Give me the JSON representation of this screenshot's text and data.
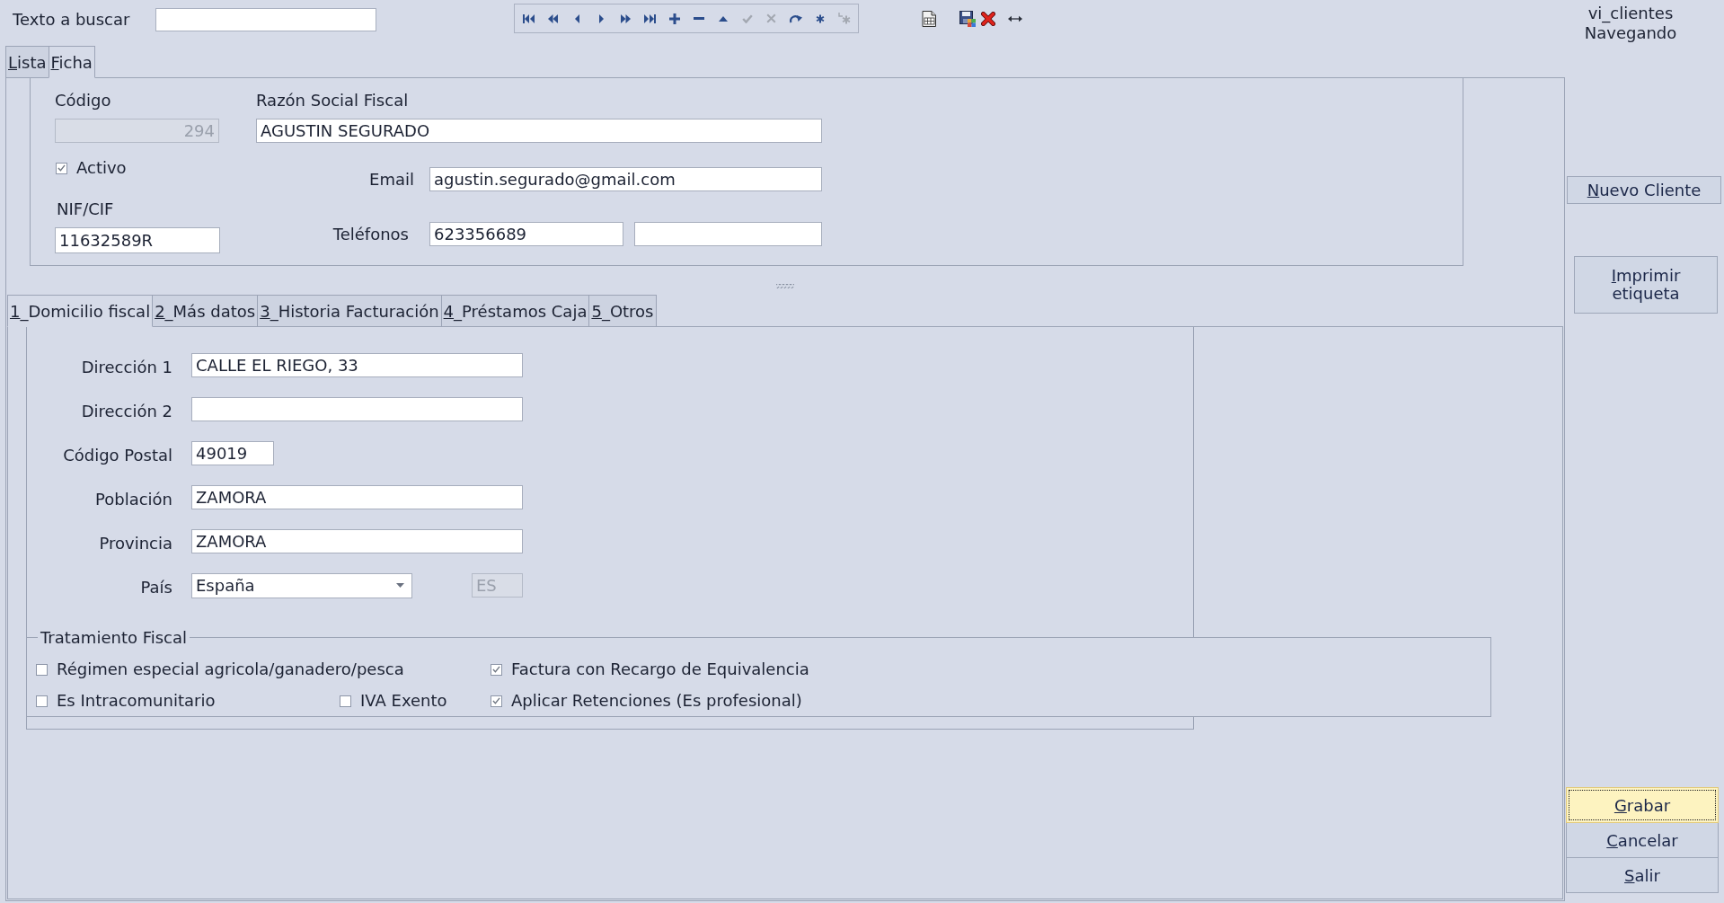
{
  "search": {
    "label": "Texto a buscar"
  },
  "toolbar": {
    "buttons": [
      {
        "kind": "first",
        "disabled": false
      },
      {
        "kind": "rewind",
        "disabled": false
      },
      {
        "kind": "previous",
        "disabled": false
      },
      {
        "kind": "next",
        "disabled": false
      },
      {
        "kind": "fast-forward",
        "disabled": false
      },
      {
        "kind": "last",
        "disabled": false
      },
      {
        "kind": "add",
        "disabled": false
      },
      {
        "kind": "remove",
        "disabled": false
      },
      {
        "kind": "up",
        "disabled": false
      },
      {
        "kind": "confirm",
        "disabled": true
      },
      {
        "kind": "cancel",
        "disabled": true
      },
      {
        "kind": "redo",
        "disabled": false
      },
      {
        "kind": "asterisk",
        "disabled": false
      },
      {
        "kind": "asterisk-corner",
        "disabled": true
      }
    ]
  },
  "status": {
    "view": "vi_clientes",
    "mode": "Navegando"
  },
  "tabs": [
    {
      "label": "Lista",
      "selected": false
    },
    {
      "label": "Ficha",
      "selected": true
    }
  ],
  "header": {
    "codigo": {
      "label": "Código",
      "value": "294",
      "disabled": true
    },
    "razon_social": {
      "label": "Razón Social Fiscal",
      "value": "AGUSTIN SEGURADO"
    },
    "activo": {
      "label": "Activo",
      "checked": true
    },
    "email": {
      "label": "Email",
      "value": "agustin.segurado@gmail.com"
    },
    "nif": {
      "label": "NIF/CIF",
      "value": "11632589R"
    },
    "telefonos": {
      "label": "Teléfonos",
      "value": "623356689"
    }
  },
  "detail_tabs": [
    {
      "label": "1_Domicilio fiscal",
      "selected": true
    },
    {
      "label": "2_Más datos",
      "selected": false
    },
    {
      "label": "3_Historia Facturación",
      "selected": false
    },
    {
      "label": "4_Préstamos Caja",
      "selected": false
    },
    {
      "label": "5_Otros",
      "selected": false
    }
  ],
  "address": {
    "rows": [
      {
        "kind": "text",
        "label": "Dirección 1",
        "value": "CALLE EL RIEGO, 33"
      },
      {
        "kind": "text",
        "label": "Dirección 2"
      },
      {
        "kind": "short",
        "label": "Código Postal",
        "value": "49019"
      },
      {
        "kind": "text",
        "label": "Población",
        "value": "ZAMORA"
      },
      {
        "kind": "text",
        "label": "Provincia",
        "value": "ZAMORA"
      },
      {
        "kind": "select",
        "label": "País",
        "value": "España",
        "code": {
          "value": "ES",
          "disabled": true
        }
      }
    ]
  },
  "tax": {
    "title": "Tratamiento Fiscal",
    "rows": [
      [
        {
          "label": "Régimen especial agricola/ganadero/pesca",
          "checked": false
        },
        "",
        {
          "label": "Factura con Recargo de Equivalencia",
          "checked": true
        }
      ],
      [
        {
          "label": "Es Intracomunitario",
          "checked": false
        },
        {
          "label": "IVA Exento",
          "checked": false
        },
        {
          "label": "Aplicar Retenciones (Es profesional)",
          "checked": true
        }
      ]
    ]
  },
  "new_button": {
    "label": "Nuevo Cliente"
  },
  "print_button": {
    "label": "Imprimir etiqueta"
  },
  "actions": [
    {
      "label": "Grabar",
      "focused": true
    },
    {
      "label": "Cancelar",
      "focused": false
    },
    {
      "label": "Salir",
      "focused": false
    }
  ]
}
